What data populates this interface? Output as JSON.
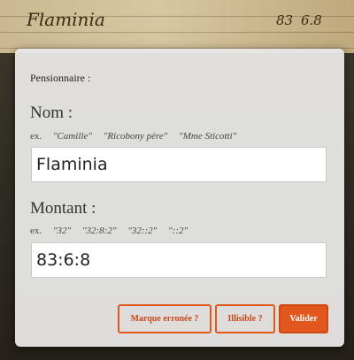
{
  "background": {
    "manuscript_lines": [
      "Flaminia ............ 83 6.8"
    ],
    "fragments": [
      "Flaminia",
      "83",
      "6.8"
    ]
  },
  "form": {
    "title": "Pensionnaire :",
    "name_field": {
      "label": "Nom :",
      "examples_prefix": "ex.",
      "examples": [
        "\"Camille\"",
        "\"Ricobony père\"",
        "\"Mme Sticotti\""
      ],
      "value": "Flaminia"
    },
    "amount_field": {
      "label": "Montant :",
      "examples_prefix": "ex.",
      "examples": [
        "\"32\"",
        "\"32:8:2\"",
        "\"32::2\"",
        "\"::2\""
      ],
      "value": "83:6:8"
    },
    "buttons": {
      "wrong_mark": "Marque erronée ?",
      "illegible": "Illisible ?",
      "validate": "Valider"
    }
  },
  "colors": {
    "accent": "#e2571d",
    "modal_bg": "#e8e8e6"
  }
}
